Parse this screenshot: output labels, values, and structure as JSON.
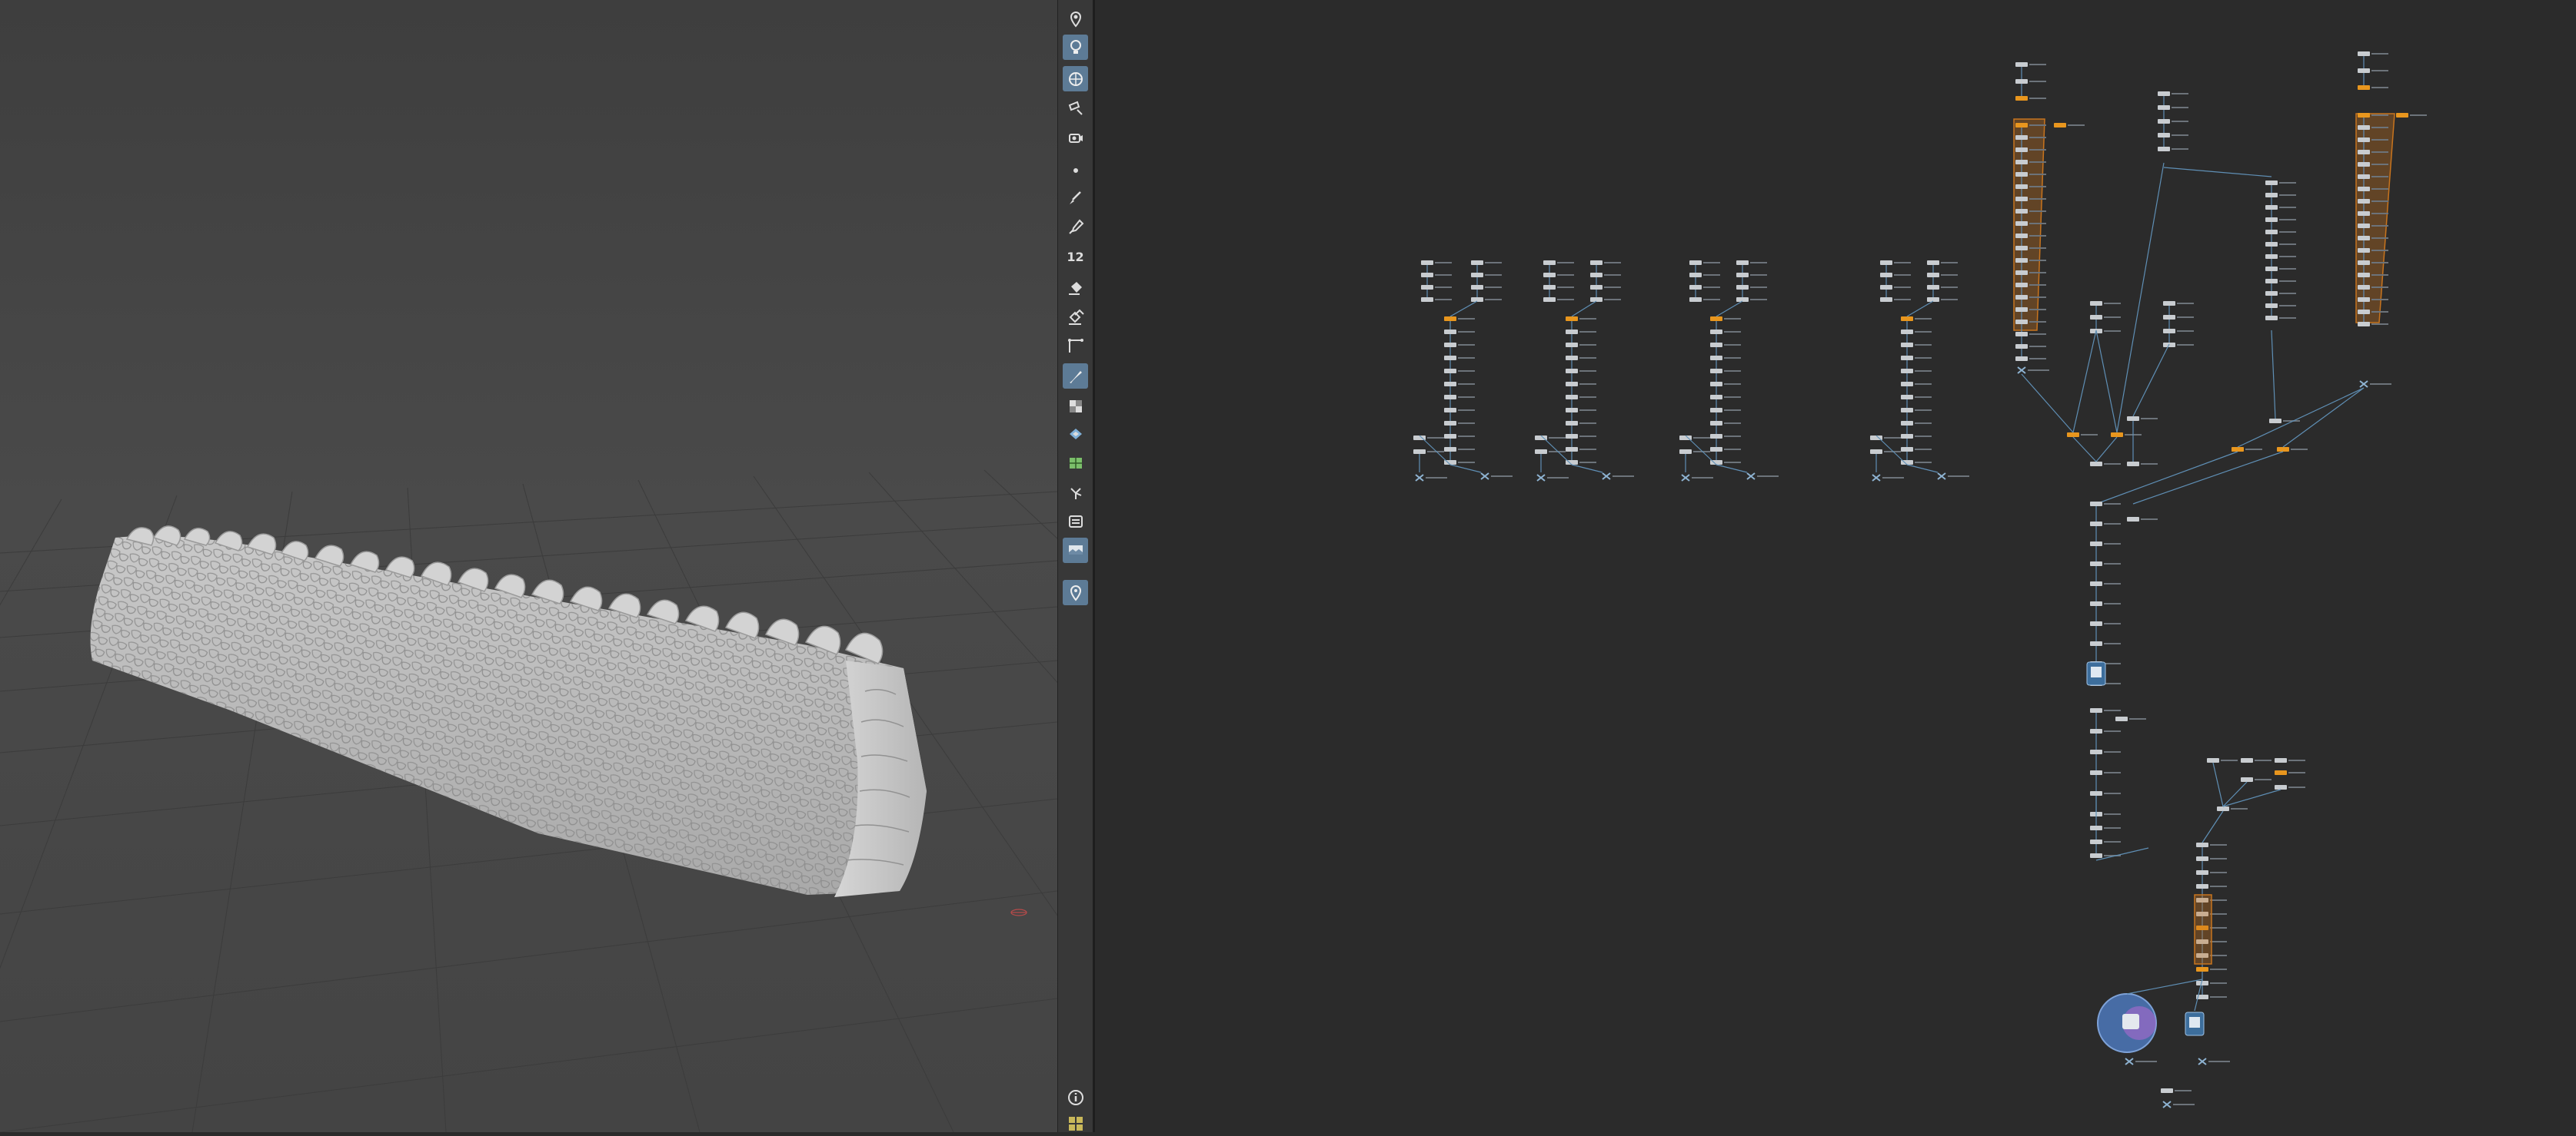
{
  "toolbar": {
    "tools": [
      {
        "name": "light-pin-icon",
        "active": false
      },
      {
        "name": "light-bulb-icon",
        "active": true
      },
      {
        "name": "environment-light-icon",
        "active": true
      },
      {
        "name": "spot-light-icon",
        "active": false
      },
      {
        "name": "camera-icon",
        "active": false
      },
      {
        "name": "point-icon",
        "active": false
      },
      {
        "name": "paint-brush-icon",
        "active": false
      },
      {
        "name": "pipette-icon",
        "active": false
      },
      {
        "name": "number-tool-icon",
        "active": false,
        "label": "12"
      },
      {
        "name": "bucket-fill-icon",
        "active": false
      },
      {
        "name": "multi-bucket-icon",
        "active": false
      },
      {
        "name": "angle-tool-icon",
        "active": false
      },
      {
        "name": "pen-tool-icon",
        "active": true
      },
      {
        "name": "checker-pattern-icon",
        "active": false
      },
      {
        "name": "layers-diamond-icon",
        "active": false
      },
      {
        "name": "uv-map-icon",
        "active": false
      },
      {
        "name": "branch-tool-icon",
        "active": false
      },
      {
        "name": "list-stack-icon",
        "active": false
      },
      {
        "name": "display-monitor-icon",
        "active": true
      },
      {
        "name": "pin-marker-icon",
        "active": true
      }
    ],
    "info_icon": "info-icon",
    "grid_icon": "grid-layout-icon"
  },
  "viewport": {
    "model": "stone-wall-mesh",
    "colors": {
      "stone": "#bdbdbd",
      "floor_grid": "#3a3a3a",
      "axis": "#b84a4a"
    }
  },
  "network": {
    "colors": {
      "node": "#c8ccd0",
      "highlight": "#e8961e",
      "wire": "#5f8fb5",
      "group": "#c8741e"
    }
  }
}
